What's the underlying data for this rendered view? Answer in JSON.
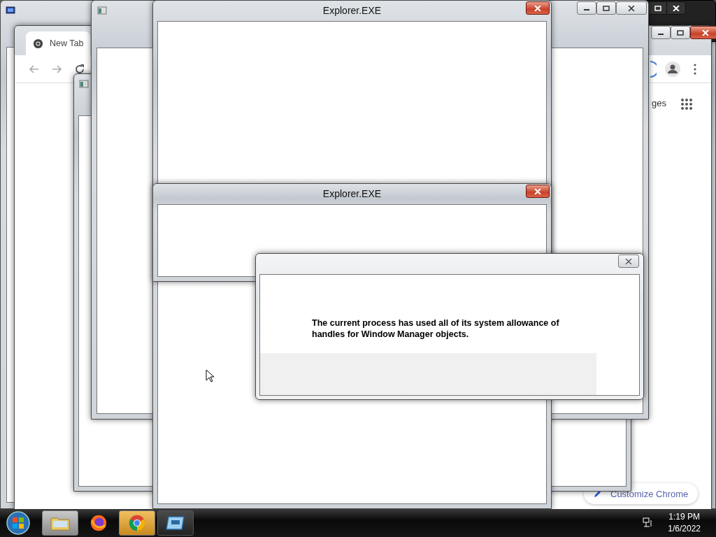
{
  "chrome": {
    "tab": {
      "label": "New Tab",
      "selected": true
    },
    "shortcut_label": "ges",
    "customize_button": "Customize Chrome"
  },
  "explorer_windows": [
    {
      "title": "Explorer.EXE"
    },
    {
      "title": "Explorer.EXE"
    }
  ],
  "error_dialog": {
    "message": "The current process has used all of its system allowance of handles for Window Manager objects."
  },
  "taskbar": {
    "items": [
      {
        "kind": "folder",
        "highlighted": true
      },
      {
        "kind": "firefox",
        "highlighted": false
      },
      {
        "kind": "chrome",
        "highlighted": true
      },
      {
        "kind": "app",
        "highlighted": false
      }
    ],
    "clock": {
      "time": "1:19 PM",
      "date": "1/6/2022"
    }
  }
}
